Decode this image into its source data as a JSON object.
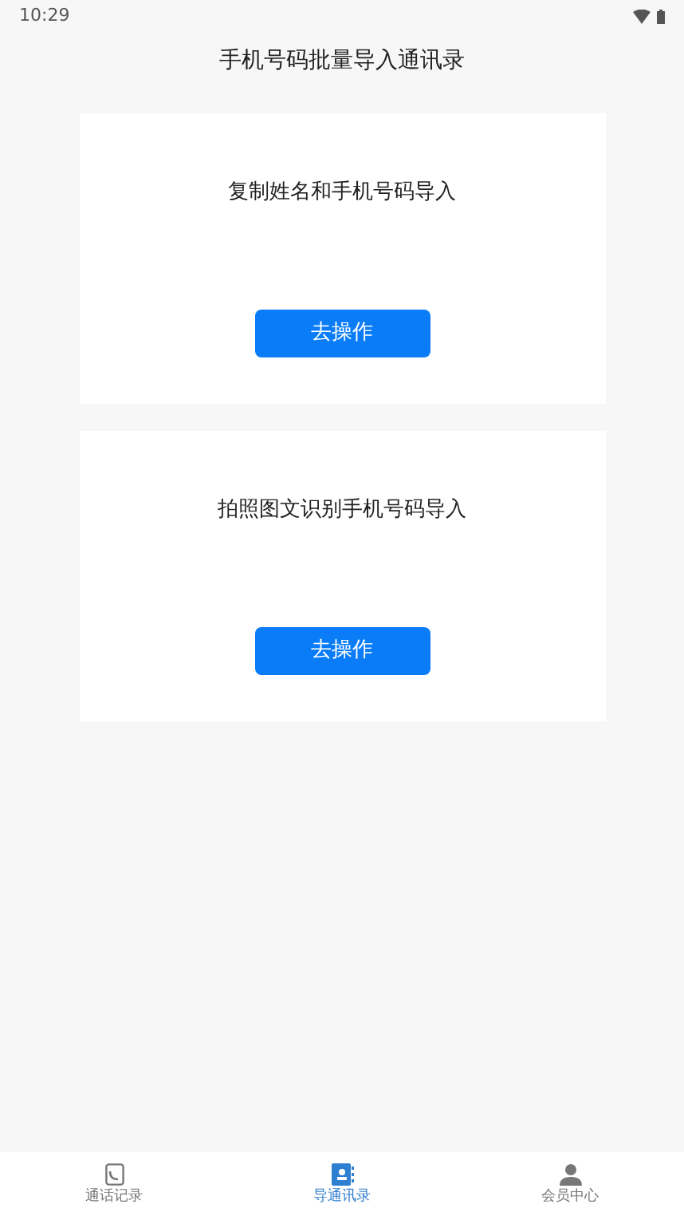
{
  "status_bar": {
    "time": "10:29"
  },
  "header": {
    "title": "手机号码批量导入通讯录"
  },
  "cards": [
    {
      "title": "复制姓名和手机号码导入",
      "button": "去操作"
    },
    {
      "title": "拍照图文识别手机号码导入",
      "button": "去操作"
    }
  ],
  "tab_bar": [
    {
      "kind": "phone",
      "label": "通话记录",
      "selected": false
    },
    {
      "kind": "contacts",
      "label": "导通讯录",
      "selected": true
    },
    {
      "kind": "person",
      "label": "会员中心",
      "selected": false
    }
  ]
}
